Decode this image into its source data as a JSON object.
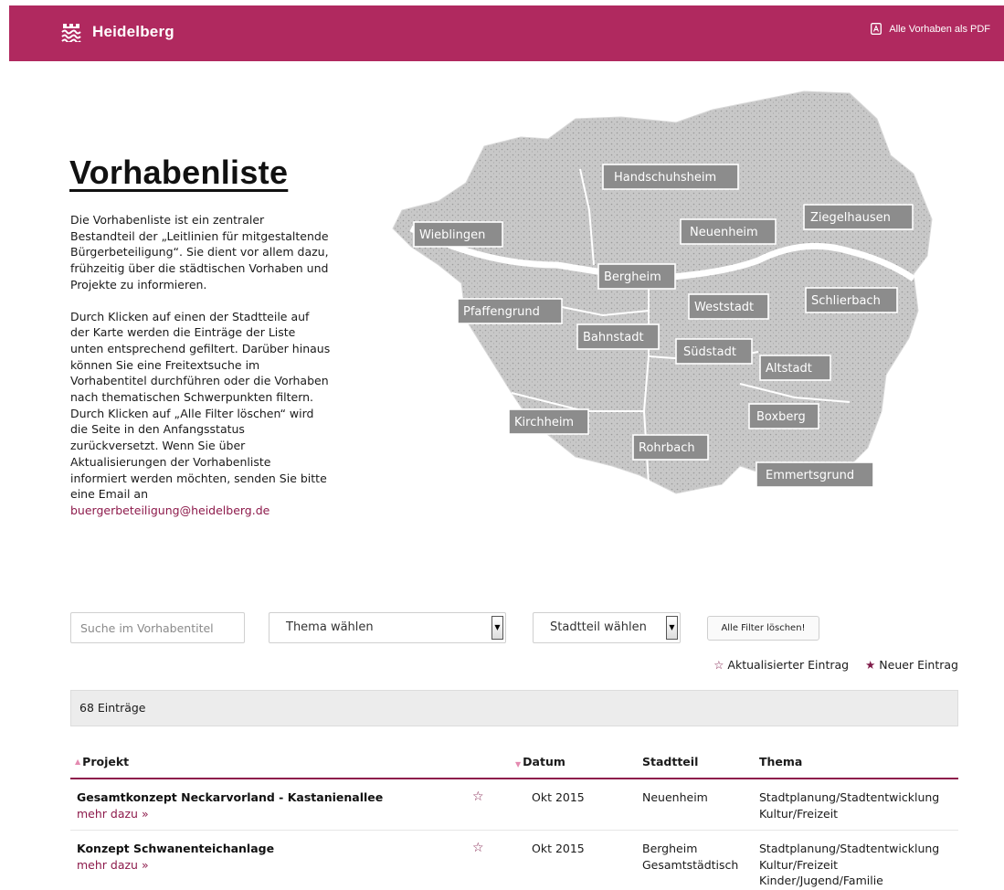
{
  "header": {
    "brand": "Heidelberg",
    "pdf_link": "Alle Vorhaben als PDF"
  },
  "intro": {
    "title": "Vorhabenliste",
    "paragraph1": "Die Vorhabenliste ist ein zentraler Bestandteil der „Leitlinien für mitgestaltende Bürgerbeteiligung“. Sie dient vor allem dazu, frühzeitig über die städtischen Vorhaben und Projekte zu informieren.",
    "paragraph2": "Durch Klicken auf einen der Stadtteile auf der Karte werden die Einträge der Liste unten entsprechend gefiltert. Darüber hinaus können Sie eine Freitextsuche im Vorhabentitel durchführen oder die Vorhaben nach thematischen Schwerpunkten filtern. Durch Klicken auf „Alle Filter löschen“ wird die Seite in den Anfangsstatus zurückversetzt. Wenn Sie über Aktualisierungen der Vorhabenliste informiert werden möchten, senden Sie bitte eine Email an",
    "email": "buergerbeteiligung@heidelberg.de"
  },
  "map": {
    "districts": [
      "Handschuhsheim",
      "Wieblingen",
      "Neuenheim",
      "Ziegelhausen",
      "Bergheim",
      "Pfaffengrund",
      "Weststadt",
      "Schlierbach",
      "Bahnstadt",
      "Südstadt",
      "Altstadt",
      "Kirchheim",
      "Boxberg",
      "Rohrbach",
      "Emmertsgrund"
    ]
  },
  "filters": {
    "search_placeholder": "Suche im Vorhabentitel",
    "theme_select": "Thema wählen",
    "district_select": "Stadtteil wählen",
    "clear_button": "Alle Filter löschen!"
  },
  "legend": {
    "updated": "Aktualisierter Eintrag",
    "new": "Neuer Eintrag",
    "updated_symbol": "☆",
    "new_symbol": "★"
  },
  "count_text": "68 Einträge",
  "table": {
    "columns": {
      "project": "Projekt",
      "date": "Datum",
      "district": "Stadtteil",
      "theme": "Thema"
    },
    "more_label": "mehr dazu »",
    "rows": [
      {
        "title": "Gesamtkonzept Neckarvorland - Kastanienallee",
        "status_symbol": "☆",
        "date": "Okt 2015",
        "district": "Neuenheim",
        "themes": "Stadtplanung/Stadtentwicklung\nKultur/Freizeit"
      },
      {
        "title": "Konzept Schwanenteichanlage",
        "status_symbol": "☆",
        "date": "Okt 2015",
        "district": "Bergheim\nGesamtstädtisch",
        "themes": "Stadtplanung/Stadtentwicklung\nKultur/Freizeit\nKinder/Jugend/Familie"
      }
    ]
  },
  "colors": {
    "brand": "#b0295f",
    "link": "#8d1a4b",
    "map_land": "#c9c9c9",
    "label_bg": "#8c8c8c"
  }
}
